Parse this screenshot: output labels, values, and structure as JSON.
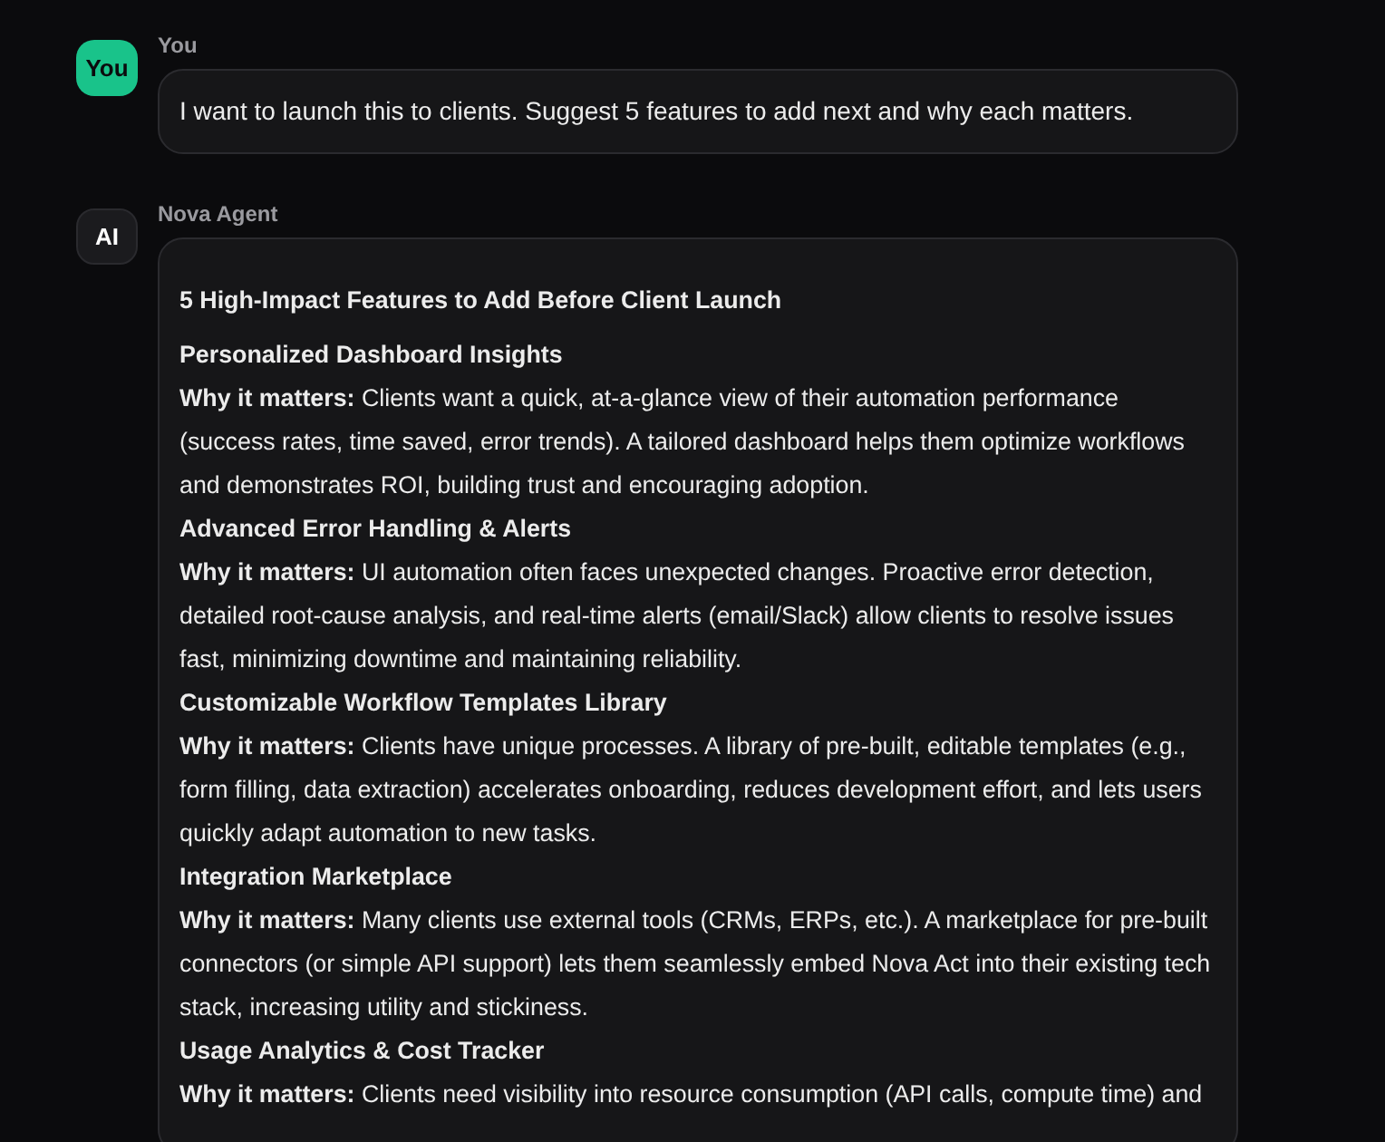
{
  "messages": [
    {
      "kind": "user",
      "avatar": "You",
      "author": "You",
      "text": "I want to launch this to clients. Suggest 5 features to add next and why each matters."
    },
    {
      "kind": "agent",
      "avatar": "AI",
      "author": "Nova Agent",
      "title": "5 High-Impact Features to Add Before Client Launch",
      "features": [
        {
          "name": "Personalized Dashboard Insights",
          "text": "**Why it matters:** Clients want a quick, at-a-glance view of their automation performance (success rates, time saved, error trends). A tailored dashboard helps them optimize workflows and demonstrates ROI, building trust and encouraging adoption."
        },
        {
          "name": "Advanced Error Handling & Alerts",
          "text": "**Why it matters:** UI automation often faces unexpected changes. Proactive error detection, detailed root-cause analysis, and real-time alerts (email/Slack) allow clients to resolve issues fast, minimizing downtime and maintaining reliability."
        },
        {
          "name": "Customizable Workflow Templates Library",
          "text": "**Why it matters:** Clients have unique processes. A library of pre-built, editable templates (e.g., form filling, data extraction) accelerates onboarding, reduces development effort, and lets users quickly adapt automation to new tasks."
        },
        {
          "name": "Integration Marketplace",
          "text": "**Why it matters:** Many clients use external tools (CRMs, ERPs, etc.). A marketplace for pre-built connectors (or simple API support) lets them seamlessly embed Nova Act into their existing tech stack, increasing utility and stickiness."
        },
        {
          "name": "Usage Analytics & Cost Tracker",
          "text": "**Why it matters:** Clients need visibility into resource consumption (API calls, compute time) and"
        }
      ]
    }
  ]
}
